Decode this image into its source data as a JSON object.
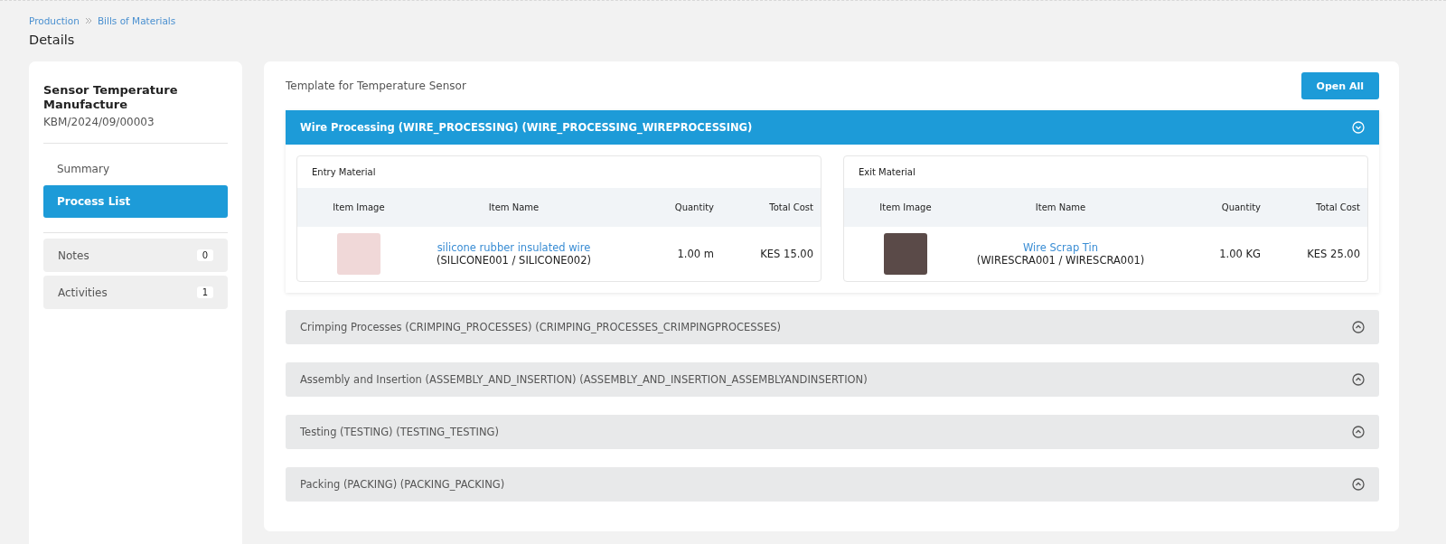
{
  "breadcrumb": [
    "Production",
    "Bills of Materials"
  ],
  "page_title": "Details",
  "sidebar": {
    "title": "Sensor Temperature Manufacture",
    "code": "KBM/2024/09/00003",
    "nav": [
      {
        "label": "Summary",
        "selected": false
      },
      {
        "label": "Process List",
        "selected": true
      }
    ],
    "panels": [
      {
        "label": "Notes",
        "count": "0"
      },
      {
        "label": "Activities",
        "count": "1"
      }
    ]
  },
  "main": {
    "template": "Template for Temperature Sensor",
    "open_all": "Open All",
    "processes": [
      {
        "title": "Wire Processing (WIRE_PROCESSING) (WIRE_PROCESSING_WIREPROCESSING)",
        "expanded": true,
        "tables": [
          {
            "title": "Entry Material",
            "columns": [
              "Item Image",
              "Item Name",
              "Quantity",
              "Total Cost"
            ],
            "rows": [
              {
                "name": "silicone rubber insulated wire",
                "codes": "(SILICONE001 / SILICONE002)",
                "quantity": "1.00 m",
                "cost": "KES 15.00"
              }
            ]
          },
          {
            "title": "Exit Material",
            "columns": [
              "Item Image",
              "Item Name",
              "Quantity",
              "Total Cost"
            ],
            "rows": [
              {
                "name": "Wire Scrap Tin",
                "codes": "(WIRESCRA001 / WIRESCRA001)",
                "quantity": "1.00 KG",
                "cost": "KES 25.00"
              }
            ]
          }
        ]
      },
      {
        "title": "Crimping Processes (CRIMPING_PROCESSES) (CRIMPING_PROCESSES_CRIMPINGPROCESSES)",
        "expanded": false
      },
      {
        "title": "Assembly and Insertion (ASSEMBLY_AND_INSERTION) (ASSEMBLY_AND_INSERTION_ASSEMBLYANDINSERTION)",
        "expanded": false
      },
      {
        "title": "Testing (TESTING) (TESTING_TESTING)",
        "expanded": false
      },
      {
        "title": "Packing (PACKING) (PACKING_PACKING)",
        "expanded": false
      }
    ]
  }
}
